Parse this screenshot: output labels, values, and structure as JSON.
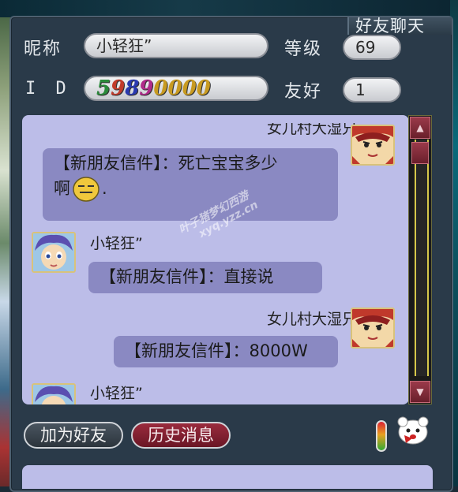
{
  "window": {
    "title": "好友聊天"
  },
  "profile": {
    "nickname_label": "昵称",
    "nickname_value": "小轻狂”",
    "level_label": "等级",
    "level_value": "69",
    "id_label": "I D",
    "id_value": "59890000",
    "friendship_label": "友好",
    "friendship_value": "1"
  },
  "messages": [
    {
      "sender": "女儿村大湿兄",
      "text": "【新朋友信件】：死亡宝宝多少",
      "text2": "啊",
      "text2_tail": ".",
      "side": "right",
      "emoji": "sleepy-face-icon"
    },
    {
      "sender": "小轻狂”",
      "text": "【新朋友信件】：直接说",
      "side": "left"
    },
    {
      "sender": "女儿村大湿兄",
      "text": "【新朋友信件】：8000W",
      "side": "right"
    },
    {
      "sender": "小轻狂”",
      "text": "",
      "side": "left"
    }
  ],
  "watermark": {
    "line1": "叶子猪梦幻西游",
    "line2": "xyq.yzz.cn"
  },
  "actions": {
    "add_friend": "加为好友",
    "history": "历史消息"
  },
  "colors": {
    "chat_bg": "#bcbde8",
    "bubble": "#8a89c2",
    "accent_red": "#7a1f2e"
  }
}
